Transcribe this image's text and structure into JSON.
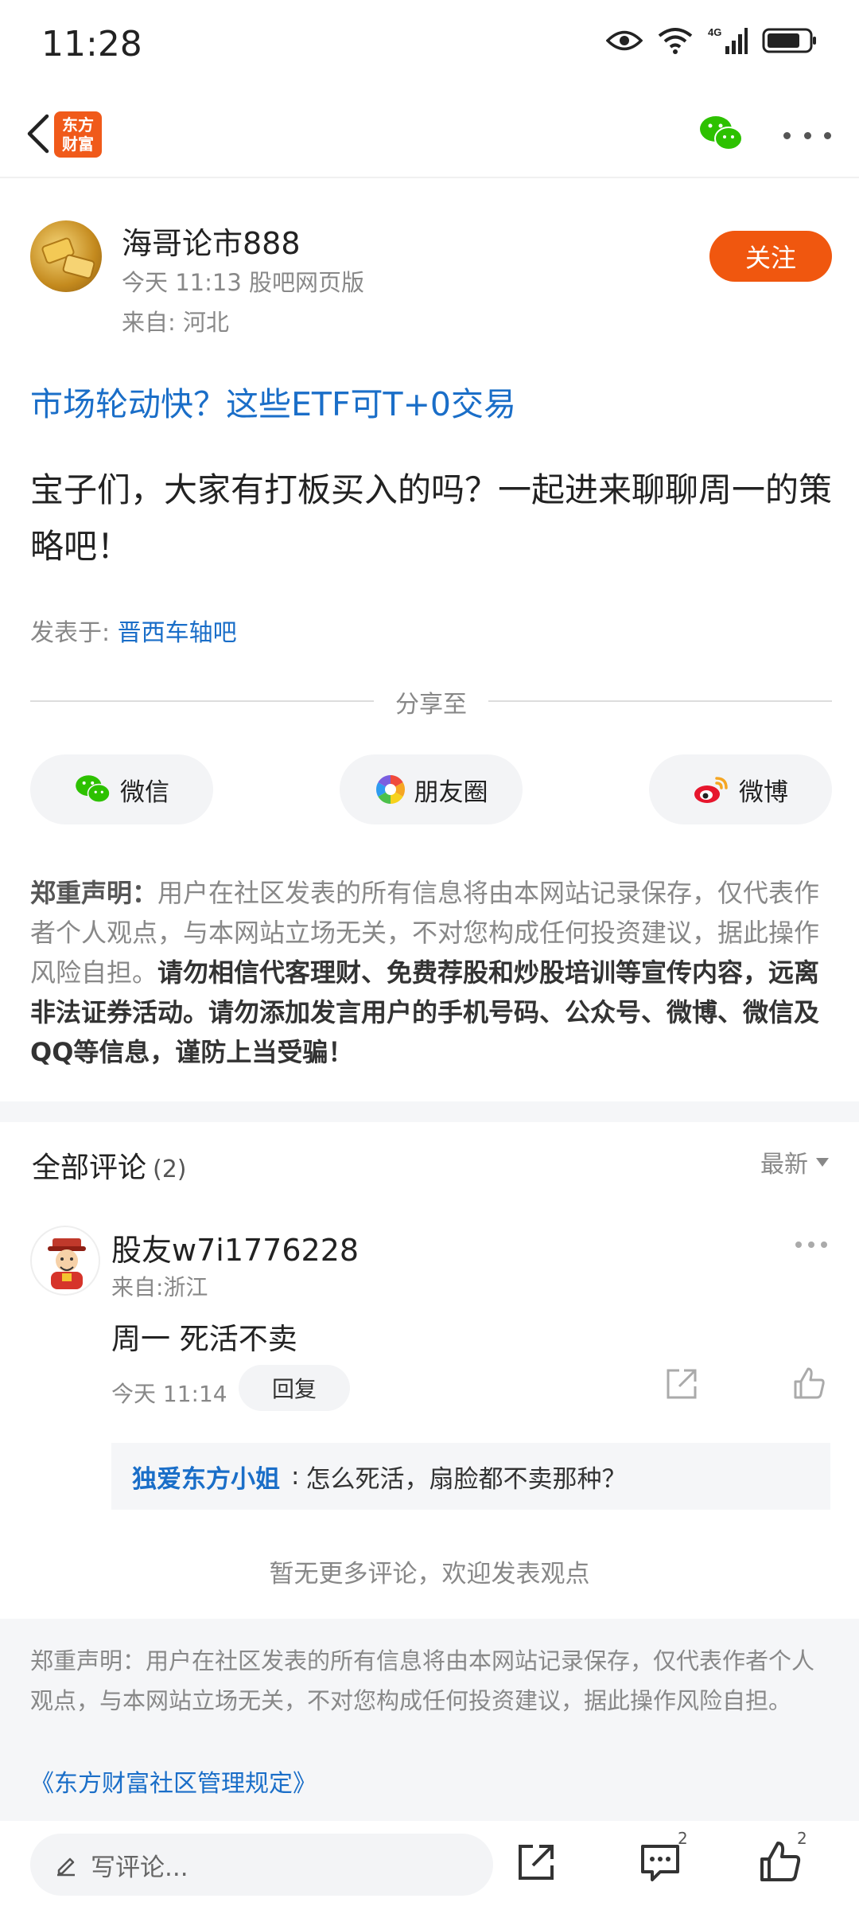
{
  "status_bar": {
    "time": "11:28",
    "network": "4G"
  },
  "nav": {
    "logo_text_line1": "东方",
    "logo_text_line2": "财富"
  },
  "author": {
    "name": "海哥论市888",
    "meta": "今天 11:13 股吧网页版",
    "from": "来自: 河北",
    "follow_label": "关注"
  },
  "post": {
    "title": "市场轮动快？这些ETF可T+0交易",
    "body": "宝子们，大家有打板买入的吗？一起进来聊聊周一的策略吧！",
    "board_prefix": "发表于: ",
    "board_name": "晋西车轴吧"
  },
  "share": {
    "divider_label": "分享至",
    "buttons": [
      {
        "label": "微信",
        "icon": "wechat-icon"
      },
      {
        "label": "朋友圈",
        "icon": "moments-icon"
      },
      {
        "label": "微博",
        "icon": "weibo-icon"
      }
    ]
  },
  "disclaimer": {
    "title": "郑重声明",
    "colon": "：",
    "normal": "用户在社区发表的所有信息将由本网站记录保存，仅代表作者个人观点，与本网站立场无关，不对您构成任何投资建议，据此操作风险自担。",
    "strong": "请勿相信代客理财、免费荐股和炒股培训等宣传内容，远离非法证券活动。请勿添加发言用户的手机号码、公众号、微博、微信及QQ等信息，谨防上当受骗！"
  },
  "comments": {
    "header_title": "全部评论",
    "count": "(2)",
    "sort_label": "最新",
    "items": [
      {
        "user": "股友w7i1776228",
        "from": "来自:浙江",
        "text": "周一 死活不卖",
        "time": "今天 11:14",
        "reply_label": "回复",
        "sub_reply": {
          "user": "独爱东方小姐",
          "sep": ":",
          "text": "怎么死活，扇脸都不卖那种？"
        }
      }
    ],
    "no_more": "暂无更多评论，欢迎发表观点"
  },
  "footer": {
    "disclaimer": "郑重声明：用户在社区发表的所有信息将由本网站记录保存，仅代表作者个人观点，与本网站立场无关，不对您构成任何投资建议，据此操作风险自担。",
    "link": "《东方财富社区管理规定》"
  },
  "bottom_bar": {
    "input_placeholder": "写评论...",
    "comment_count": "2",
    "like_count": "2"
  },
  "colors": {
    "accent": "#f0570f",
    "link": "#1a6ec8",
    "muted": "#888888"
  }
}
